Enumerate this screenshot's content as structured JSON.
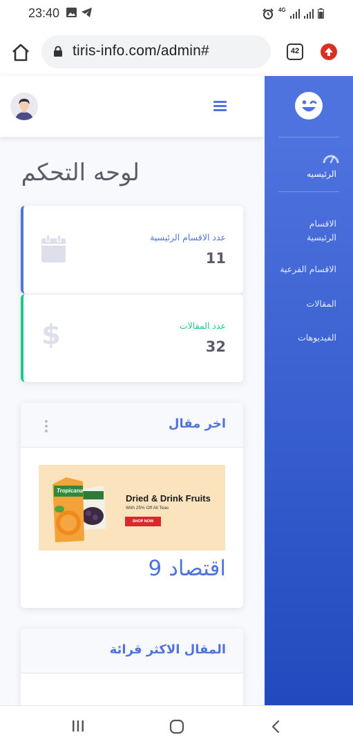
{
  "statusbar": {
    "time": "23:40",
    "network": "4G",
    "icons": [
      "gallery-icon",
      "telegram-icon",
      "alarm-icon",
      "signal-icon",
      "signal-icon",
      "battery-icon"
    ]
  },
  "browser": {
    "url": "tiris-info.com/admin#",
    "tab_count": "42",
    "icons": [
      "home-icon",
      "lock-icon",
      "tabs-icon",
      "update-icon"
    ]
  },
  "sidebar": {
    "brand_icon": "smiley-wink-icon",
    "items": [
      {
        "label": "الرئيسيه",
        "icon": "tachometer-icon",
        "active": true
      },
      {
        "label": "الاقسام الرئيسية"
      },
      {
        "label": "الاقسام الفرعية"
      },
      {
        "label": "المقالات"
      },
      {
        "label": "الفيديوهات"
      }
    ],
    "colors": {
      "gradient_top": "#4e73df",
      "gradient_bottom": "#224abe"
    }
  },
  "topbar": {
    "avatar_icon": "user-avatar-icon",
    "menu_icon": "hamburger-icon"
  },
  "main": {
    "page_title": "لوحه التحكم",
    "stats": [
      {
        "label": "عدد الاقسام الرئيسية",
        "value": "11",
        "icon": "calendar-icon",
        "color": "#4e73df"
      },
      {
        "label": "عدد المقالات",
        "value": "32",
        "icon": "dollar-icon",
        "color": "#1cc88a"
      }
    ],
    "latest_article": {
      "header": "اخر مقال",
      "banner": {
        "product_text": "Tropicana",
        "title": "Dried & Drink Fruits",
        "subtitle": "With 25% Off All Teas",
        "button": "SHOP NOW"
      },
      "title": "اقتصاد 9"
    },
    "most_read": {
      "header": "المقال الاكثر قرائة"
    }
  },
  "navbar": {
    "icons": [
      "recent-apps-icon",
      "home-circle-icon",
      "back-icon"
    ]
  }
}
